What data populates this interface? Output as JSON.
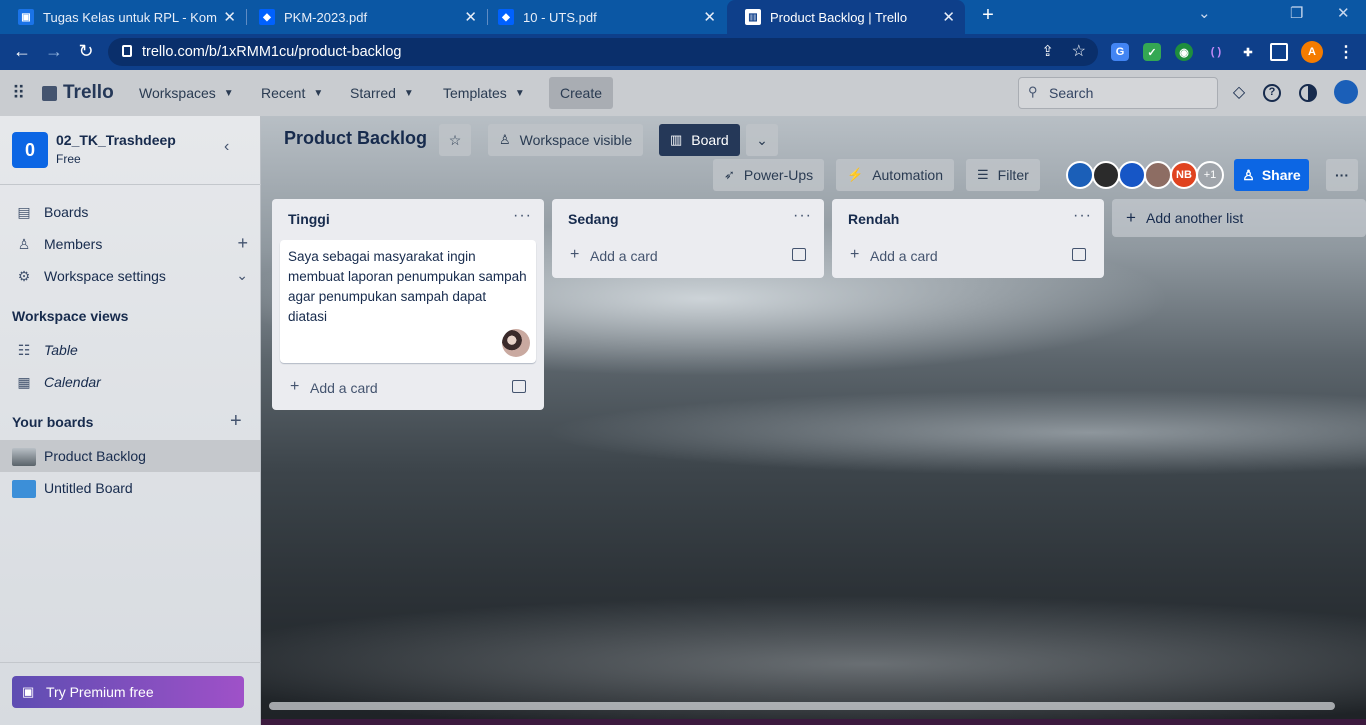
{
  "browser": {
    "tabs": [
      {
        "title": "Tugas Kelas untuk RPL - Komputer",
        "icon": "classroom-icon",
        "color": "#1a73e8"
      },
      {
        "title": "PKM-2023.pdf",
        "icon": "dropbox-icon",
        "color": "#0061fe"
      },
      {
        "title": "10 - UTS.pdf",
        "icon": "dropbox-icon",
        "color": "#0061fe"
      },
      {
        "title": "Product Backlog | Trello",
        "icon": "trello-icon",
        "color": "#ffffff"
      }
    ],
    "new_tab": "+",
    "url": "trello.com/b/1xRMM1cu/product-backlog",
    "profile_initial": "A"
  },
  "header": {
    "logo": "Trello",
    "menus": [
      {
        "label": "Workspaces"
      },
      {
        "label": "Recent"
      },
      {
        "label": "Starred"
      },
      {
        "label": "Templates"
      }
    ],
    "create": "Create",
    "search_placeholder": "Search"
  },
  "sidebar": {
    "workspace_initial": "0",
    "workspace_name": "02_TK_Trashdeep",
    "plan": "Free",
    "items": [
      {
        "label": "Boards",
        "icon": "boards-icon"
      },
      {
        "label": "Members",
        "icon": "members-icon"
      },
      {
        "label": "Workspace settings",
        "icon": "gear-icon"
      }
    ],
    "views_heading": "Workspace views",
    "views": [
      {
        "label": "Table",
        "icon": "table-icon"
      },
      {
        "label": "Calendar",
        "icon": "calendar-icon"
      }
    ],
    "boards_heading": "Your boards",
    "boards": [
      {
        "label": "Product Backlog",
        "color": "#7a8087"
      },
      {
        "label": "Untitled Board",
        "color": "#3c8fd8"
      }
    ],
    "premium": "Try Premium free"
  },
  "board": {
    "title": "Product Backlog",
    "visibility": "Workspace visible",
    "view": "Board",
    "powerups": "Power-Ups",
    "automation": "Automation",
    "filter": "Filter",
    "members": [
      {
        "initials": "",
        "color": "#1b5fb8"
      },
      {
        "initials": "",
        "color": "#2b2b2b"
      },
      {
        "initials": "",
        "color": "#1656c6"
      },
      {
        "initials": "",
        "color": "#8d6d63"
      },
      {
        "initials": "NB",
        "color": "#e0431f"
      }
    ],
    "extra_members": "+1",
    "share": "Share",
    "lists": [
      {
        "title": "Tinggi",
        "cards": [
          "Saya sebagai masyarakat ingin membuat laporan penumpukan sampah agar penumpukan sampah dapat diatasi"
        ],
        "add_card": "Add a card"
      },
      {
        "title": "Sedang",
        "cards": [],
        "add_card": "Add a card"
      },
      {
        "title": "Rendah",
        "cards": [],
        "add_card": "Add a card"
      }
    ],
    "add_list": "Add another list"
  }
}
